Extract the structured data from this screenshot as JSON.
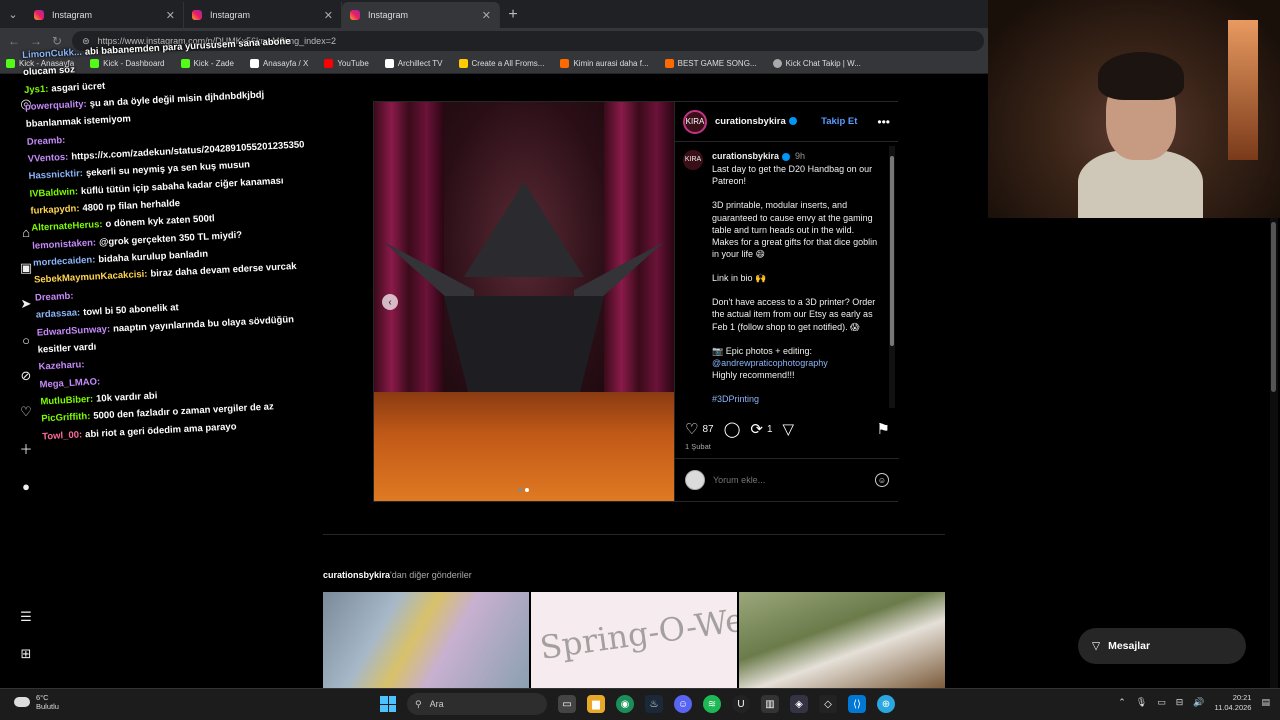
{
  "browser": {
    "tabs": [
      {
        "label": "Instagram",
        "active": false
      },
      {
        "label": "Instagram",
        "active": false
      },
      {
        "label": "Instagram",
        "active": true
      }
    ],
    "url": "https://www.instagram.com/p/DUMKx56knwM?img_index=2",
    "bookmarks": [
      {
        "label": "Kick - Anasayfa",
        "color": "#53fc18"
      },
      {
        "label": "Kick - Dashboard",
        "color": "#53fc18"
      },
      {
        "label": "Kick - Zade",
        "color": "#53fc18"
      },
      {
        "label": "Anasayfa / X",
        "color": "#ffffff"
      },
      {
        "label": "YouTube",
        "color": "#ff0000"
      },
      {
        "label": "Archillect TV",
        "color": "#ffffff"
      },
      {
        "label": "Create a All Froms...",
        "color": "#ffcc00"
      },
      {
        "label": "Kimin aurasi daha f...",
        "color": "#ff6a00"
      },
      {
        "label": "BEST GAME SONG...",
        "color": "#ff6a00"
      },
      {
        "label": "Kick Chat Takip | W...",
        "color": "#aaaaaa"
      }
    ]
  },
  "chat": [
    {
      "user": "LimonCukk...",
      "color": "#8ab4f8",
      "msg": "abi babanemden para yurususem sana abone"
    },
    {
      "user": "",
      "color": "#ffffff",
      "msg": "olucam söz"
    },
    {
      "user": "Jys1:",
      "color": "#7CFC00",
      "msg": "asgari ücret"
    },
    {
      "user": "powerquality:",
      "color": "#c58af9",
      "msg": "şu an da öyle değil misin djhdnbdkjbdj"
    },
    {
      "user": "",
      "color": "#ffffff",
      "msg": "bbanlanmak istemiyom"
    },
    {
      "user": "Dreamb:",
      "color": "#c58af9",
      "msg": ""
    },
    {
      "user": "VVentos:",
      "color": "#c58af9",
      "msg": "https://x.com/zadekun/status/2042891055201235350"
    },
    {
      "user": "Hassnicktir:",
      "color": "#8ab4f8",
      "msg": "şekerli su neymiş ya sen kuş musun"
    },
    {
      "user": "IVBaldwin:",
      "color": "#7CFC00",
      "msg": "küflü tütün içip sabaha kadar ciğer kanaması"
    },
    {
      "user": "furkapydn:",
      "color": "#ffd54f",
      "msg": "4800 rp filan herhalde"
    },
    {
      "user": "AlternateHerus:",
      "color": "#7CFC00",
      "msg": "o dönem kyk zaten 500tl"
    },
    {
      "user": "lemonistaken:",
      "color": "#c58af9",
      "msg": "@grok gerçekten 350 TL miydi?"
    },
    {
      "user": "mordecaiden:",
      "color": "#8ab4f8",
      "msg": "bidaha kurulup banladın"
    },
    {
      "user": "SebekMaymunKacakcisi:",
      "color": "#ffd54f",
      "msg": "biraz daha devam ederse vurcak"
    },
    {
      "user": "Dreamb:",
      "color": "#c58af9",
      "msg": ""
    },
    {
      "user": "ardassaa:",
      "color": "#8ab4f8",
      "msg": "towl bi 50 abonelik at"
    },
    {
      "user": "EdwardSunway:",
      "color": "#c58af9",
      "msg": "naaptın yayınlarında bu olaya sövdüğün"
    },
    {
      "user": "",
      "color": "#ffffff",
      "msg": "kesitler vardı"
    },
    {
      "user": "Kazeharu:",
      "color": "#c58af9",
      "msg": ""
    },
    {
      "user": "Mega_LMAO:",
      "color": "#c58af9",
      "msg": ""
    },
    {
      "user": "MutluBiber:",
      "color": "#7CFC00",
      "msg": "10k vardır abi"
    },
    {
      "user": "PicGriffith:",
      "color": "#7CFC00",
      "msg": "5000 den fazladır o zaman vergiler de az"
    },
    {
      "user": "Towl_00:",
      "color": "#ff6a9a",
      "msg": "abi riot a geri ödedim ama parayo"
    }
  ],
  "post": {
    "author": "curationsbykira",
    "avatar_text": "KIRA",
    "follow_label": "Takip Et",
    "more_label": "•••",
    "time": "9h",
    "caption": [
      "Last day to get the D20 Handbag on our Patreon!",
      "3D printable, modular inserts, and guaranteed to cause envy at the gaming table and turn heads out in the wild. Makes for a great gifts for that dice goblin in your life 😄",
      "Link in bio 🙌",
      "Don't have access to a 3D printer? Order the actual item from our Etsy as early as Feb 1 (follow shop to get notified). 😱"
    ],
    "photo_line": "📷 Epic photos + editing:",
    "photo_credit": "@andrewpraticophotography",
    "recommend": "Highly recommend!!!",
    "hashtag": "#3DPrinting",
    "likes": "87",
    "reposts": "1",
    "date": "1 Şubat",
    "comment_placeholder": "Yorum ekle..."
  },
  "more_posts": {
    "user": "curationsbykira",
    "suffix": "'dan diğer gönderiler",
    "thumb2_text": "Spring-O-Ween"
  },
  "messages_label": "Mesajlar",
  "taskbar": {
    "temp": "6°C",
    "weather": "Bulutlu",
    "search": "Ara",
    "time": "20:21",
    "date": "11.04.2026"
  },
  "colors": {
    "accent": "#0095f6",
    "follow": "#5b9bff"
  }
}
